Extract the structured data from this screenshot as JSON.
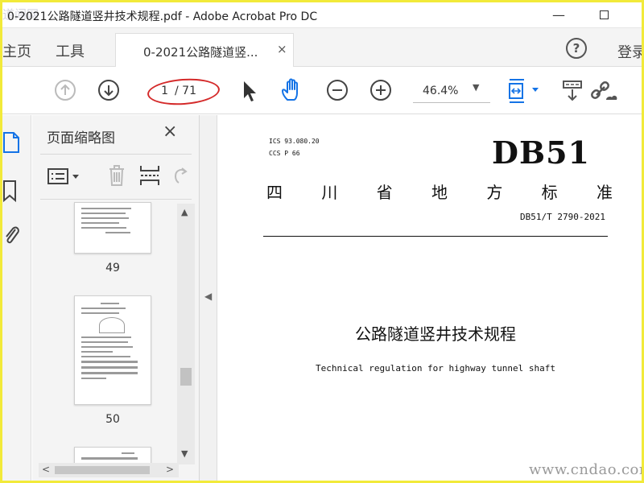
{
  "window": {
    "title": "0-2021公路隧道竖井技术规程.pdf - Adobe Acrobat Pro DC",
    "watermark_top": "道闻网",
    "minimize_icon": "minimize-icon",
    "maximize_icon": "maximize-icon"
  },
  "tabs": {
    "home": "主页",
    "tools": "工具",
    "document_tab": "0-2021公路隧道竖...",
    "close": "×",
    "help": "?",
    "login": "登录"
  },
  "toolbar": {
    "page_current": "1",
    "page_total": "/ 71",
    "zoom": "46.4%",
    "zoom_dropdown": "▼",
    "annotation_color": "#d42a2a",
    "accent_color": "#1473e6"
  },
  "panel": {
    "title": "页面缩略图",
    "close": "×",
    "thumbnails": [
      {
        "label": "49"
      },
      {
        "label": "50"
      }
    ],
    "scroll_up": "▲",
    "scroll_down": "▼",
    "scroll_left": "<",
    "scroll_right": ">"
  },
  "divider": {
    "collapse": "◀"
  },
  "document": {
    "ics": "ICS 93.080.20",
    "ccs": "CCS P 66",
    "code": "DB51",
    "province_chars": [
      "四",
      "川",
      "省",
      "地",
      "方",
      "标",
      "准"
    ],
    "standard_no": "DB51/T 2790-2021",
    "title_cn": "公路隧道竖井技术规程",
    "title_en": "Technical regulation for highway tunnel shaft"
  },
  "watermark_bottom": "www.cndao.com"
}
